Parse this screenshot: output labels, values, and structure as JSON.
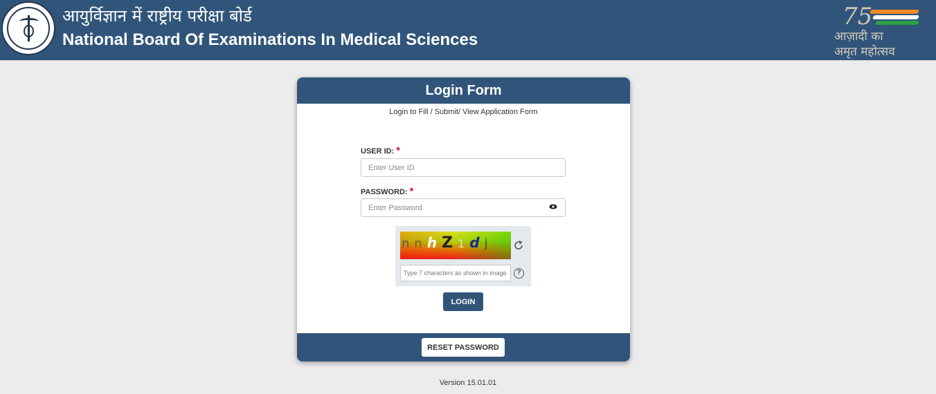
{
  "header": {
    "title_hindi": "आयुर्विज्ञान में राष्ट्रीय परीक्षा बोर्ड",
    "title_english": "National Board Of Examinations In Medical Sciences",
    "emblem": {
      "number": "75",
      "line1": "आज़ादी का",
      "line2": "अमृत महोत्सव"
    }
  },
  "form": {
    "title": "Login Form",
    "subtitle": "Login to Fill / Submit/ View Application Form",
    "user_id_label": "USER ID:",
    "user_id_placeholder": "Enter User ID",
    "password_label": "PASSWORD:",
    "password_placeholder": "Enter Password",
    "required_mark": "*",
    "captcha": {
      "chars": [
        "n",
        "n",
        "h",
        "Z",
        "1",
        "d",
        "j"
      ],
      "placeholder": "Type 7 characters as shown in image",
      "help_symbol": "?"
    },
    "login_label": "LOGIN",
    "reset_label": "RESET PASSWORD"
  },
  "footer": {
    "version": "Version 15.01.01"
  },
  "colors": {
    "primary": "#31557a",
    "background": "#ececec",
    "required": "#d0021b"
  }
}
